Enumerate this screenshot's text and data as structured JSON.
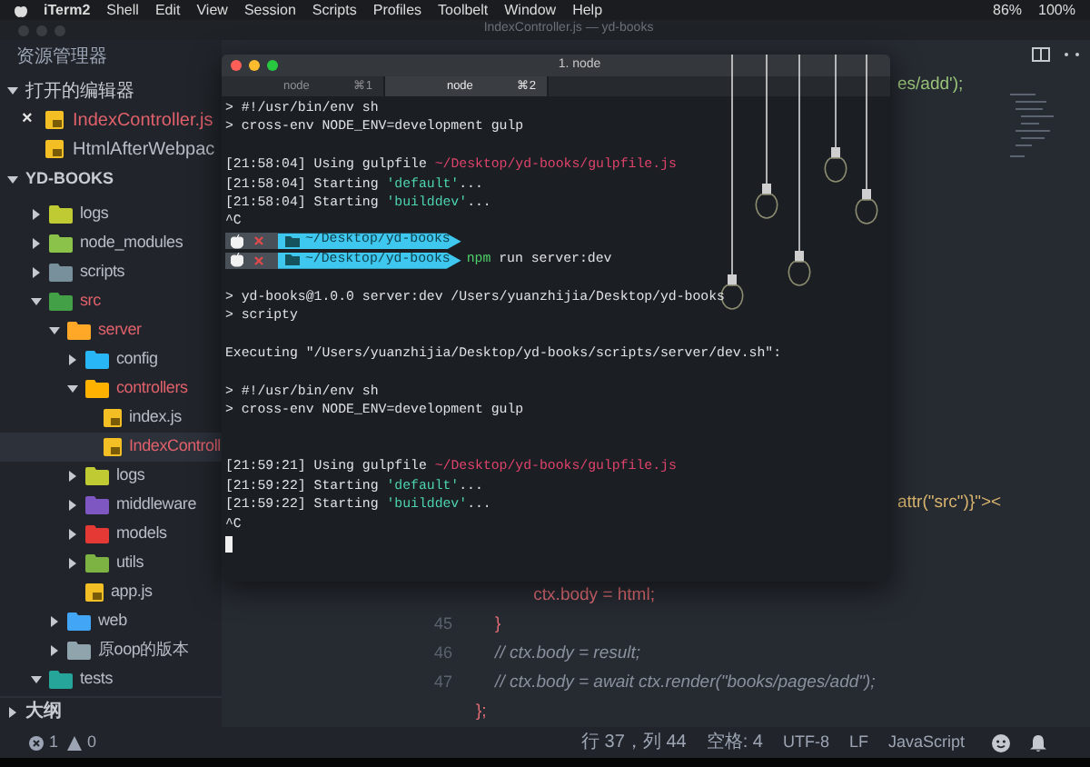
{
  "menu_bar": {
    "app": "iTerm2",
    "items": [
      "Shell",
      "Edit",
      "View",
      "Session",
      "Scripts",
      "Profiles",
      "Toolbelt",
      "Window",
      "Help"
    ],
    "battery": "86%",
    "volume": "100%"
  },
  "window": {
    "title": "IndexController.js — yd-books"
  },
  "sidebar": {
    "title": "资源管理器",
    "open_editors": {
      "title": "打开的编辑器",
      "expanded": true,
      "items": [
        {
          "name": "IndexController.js",
          "close": "×",
          "modified": true
        },
        {
          "name": "HtmlAfterWebpac",
          "modified": false
        }
      ]
    },
    "project": {
      "title": "YD-BOOKS",
      "expanded": true,
      "tree": [
        {
          "name": "logs",
          "kind": "folder",
          "color": "#c0ca33",
          "expanded": false,
          "modified": false,
          "selected": false
        },
        {
          "name": "node_modules",
          "kind": "folder",
          "color": "#8bc34a",
          "expanded": false,
          "modified": false,
          "selected": false
        },
        {
          "name": "scripts",
          "kind": "folder",
          "color": "#78909c",
          "expanded": false,
          "modified": false,
          "selected": false
        },
        {
          "name": "src",
          "kind": "folder",
          "color": "#43a047",
          "expanded": true,
          "modified": true,
          "selected": false,
          "children": [
            {
              "name": "server",
              "kind": "folder",
              "color": "#ffa726",
              "expanded": true,
              "modified": true,
              "selected": false,
              "children": [
                {
                  "name": "config",
                  "kind": "folder",
                  "color": "#29b6f6",
                  "expanded": false,
                  "modified": false,
                  "selected": false
                },
                {
                  "name": "controllers",
                  "kind": "folder",
                  "color": "#ffb300",
                  "expanded": true,
                  "modified": true,
                  "selected": false,
                  "children": [
                    {
                      "name": "index.js",
                      "kind": "file",
                      "modified": false,
                      "selected": false
                    },
                    {
                      "name": "IndexControll",
                      "kind": "file",
                      "modified": true,
                      "selected": true
                    }
                  ]
                },
                {
                  "name": "logs",
                  "kind": "folder",
                  "color": "#c0ca33",
                  "expanded": false,
                  "modified": false,
                  "selected": false
                },
                {
                  "name": "middleware",
                  "kind": "folder",
                  "color": "#7e57c2",
                  "expanded": false,
                  "modified": false,
                  "selected": false
                },
                {
                  "name": "models",
                  "kind": "folder",
                  "color": "#e53935",
                  "expanded": false,
                  "modified": false,
                  "selected": false
                },
                {
                  "name": "utils",
                  "kind": "folder",
                  "color": "#7cb342",
                  "expanded": false,
                  "modified": false,
                  "selected": false
                },
                {
                  "name": "app.js",
                  "kind": "file",
                  "modified": false,
                  "selected": false
                }
              ]
            },
            {
              "name": "web",
              "kind": "folder",
              "color": "#42a5f5",
              "expanded": false,
              "modified": false,
              "selected": false
            },
            {
              "name": "原oop的版本",
              "kind": "folder",
              "color": "#90a4ae",
              "expanded": false,
              "modified": false,
              "selected": false
            }
          ]
        },
        {
          "name": "tests",
          "kind": "folder",
          "color": "#26a69a",
          "expanded": true,
          "modified": false,
          "selected": false
        }
      ]
    },
    "outline": {
      "title": "大纲",
      "expanded": false
    }
  },
  "editor": {
    "side_fragments": [
      "es/add');",
      "attr(\"src\")}\"><"
    ],
    "lines": [
      {
        "code": "            ctx.body = html;",
        "kind": "code"
      },
      {
        "number": "45",
        "code": "    }",
        "kind": "code"
      },
      {
        "number": "46",
        "code": "    // ctx.body = result;",
        "kind": "comment"
      },
      {
        "number": "47",
        "code": "    // ctx.body = await ctx.render(\"books/pages/add\");",
        "kind": "comment"
      },
      {
        "code": "};",
        "kind": "code"
      }
    ]
  },
  "terminal": {
    "title": "1. node",
    "tabs": [
      {
        "label": "node",
        "shortcut": "⌘1",
        "selected": false
      },
      {
        "label": "node",
        "shortcut": "⌘2",
        "selected": true
      }
    ],
    "lines": [
      {
        "kind": "text",
        "parts": [
          {
            "text": "> #!/usr/bin/env sh",
            "kind": "plain"
          }
        ]
      },
      {
        "kind": "text",
        "parts": [
          {
            "text": "> cross-env NODE_ENV=development gulp",
            "kind": "plain"
          }
        ]
      },
      {
        "kind": "blank"
      },
      {
        "kind": "text",
        "parts": [
          {
            "text": "[21:58:04] Using gulpfile ",
            "kind": "plain"
          },
          {
            "text": "~/Desktop/yd-books/gulpfile.js",
            "kind": "path"
          }
        ]
      },
      {
        "kind": "text",
        "parts": [
          {
            "text": "[21:58:04] Starting ",
            "kind": "plain"
          },
          {
            "text": "'default'",
            "kind": "string"
          },
          {
            "text": "...",
            "kind": "plain"
          }
        ]
      },
      {
        "kind": "text",
        "parts": [
          {
            "text": "[21:58:04] Starting ",
            "kind": "plain"
          },
          {
            "text": "'builddev'",
            "kind": "string"
          },
          {
            "text": "...",
            "kind": "plain"
          }
        ]
      },
      {
        "kind": "text",
        "parts": [
          {
            "text": "^C",
            "kind": "plain"
          }
        ]
      },
      {
        "kind": "prompt",
        "path": "~/Desktop/yd-books"
      },
      {
        "kind": "prompt",
        "path": "~/Desktop/yd-books",
        "parts": [
          {
            "text": "npm",
            "kind": "command"
          },
          {
            "text": " run server:dev",
            "kind": "plain"
          }
        ]
      },
      {
        "kind": "blank"
      },
      {
        "kind": "text",
        "parts": [
          {
            "text": "> yd-books@1.0.0 server:dev /Users/yuanzhijia/Desktop/yd-books",
            "kind": "plain"
          }
        ]
      },
      {
        "kind": "text",
        "parts": [
          {
            "text": "> scripty",
            "kind": "plain"
          }
        ]
      },
      {
        "kind": "blank"
      },
      {
        "kind": "text",
        "parts": [
          {
            "text": "Executing \"/Users/yuanzhijia/Desktop/yd-books/scripts/server/dev.sh\":",
            "kind": "plain"
          }
        ]
      },
      {
        "kind": "blank"
      },
      {
        "kind": "text",
        "parts": [
          {
            "text": "> #!/usr/bin/env sh",
            "kind": "plain"
          }
        ]
      },
      {
        "kind": "text",
        "parts": [
          {
            "text": "> cross-env NODE_ENV=development gulp",
            "kind": "plain"
          }
        ]
      },
      {
        "kind": "blank"
      },
      {
        "kind": "blank"
      },
      {
        "kind": "text",
        "parts": [
          {
            "text": "[21:59:21] Using gulpfile ",
            "kind": "plain"
          },
          {
            "text": "~/Desktop/yd-books/gulpfile.js",
            "kind": "path"
          }
        ]
      },
      {
        "kind": "text",
        "parts": [
          {
            "text": "[21:59:22] Starting ",
            "kind": "plain"
          },
          {
            "text": "'default'",
            "kind": "string"
          },
          {
            "text": "...",
            "kind": "plain"
          }
        ]
      },
      {
        "kind": "text",
        "parts": [
          {
            "text": "[21:59:22] Starting ",
            "kind": "plain"
          },
          {
            "text": "'builddev'",
            "kind": "string"
          },
          {
            "text": "...",
            "kind": "plain"
          }
        ]
      },
      {
        "kind": "text",
        "parts": [
          {
            "text": "^C",
            "kind": "plain"
          }
        ]
      },
      {
        "kind": "cursor"
      }
    ]
  },
  "status_bar": {
    "errors": "1",
    "warnings": "0",
    "position": "行 37，列 44",
    "indent": "空格: 4",
    "encoding": "UTF-8",
    "eol": "LF",
    "language": "JavaScript"
  }
}
